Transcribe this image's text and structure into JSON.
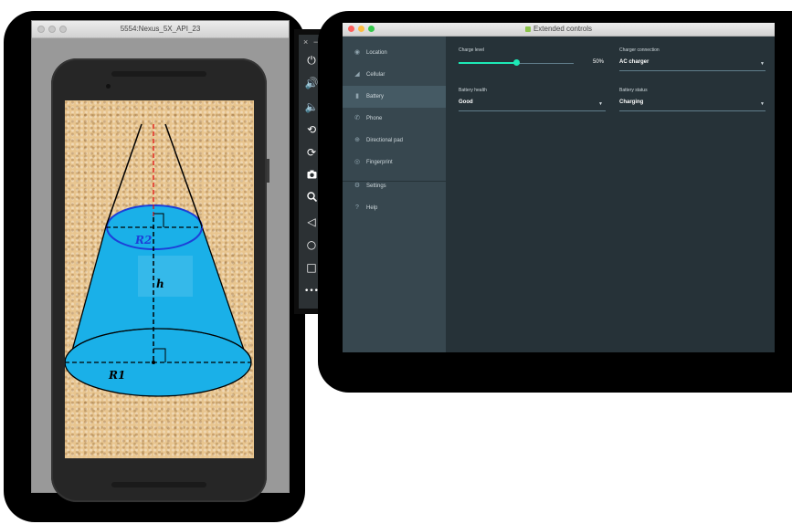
{
  "emulator": {
    "title": "5554:Nexus_5X_API_23",
    "diagram": {
      "label_top_radius": "R2",
      "label_height": "h",
      "label_bottom_radius": "R1"
    }
  },
  "toolbar": {
    "close": "×",
    "minimize": "−",
    "icons": [
      "power-icon",
      "volume-up-icon",
      "volume-down-icon",
      "rotate-left-icon",
      "rotate-right-icon",
      "camera-icon",
      "zoom-icon",
      "back-icon",
      "home-icon",
      "overview-icon",
      "more-icon"
    ]
  },
  "extended_controls": {
    "title": "Extended controls",
    "title_icon_color": "#8bc34a",
    "nav": [
      {
        "label": "Location",
        "icon": "location-icon"
      },
      {
        "label": "Cellular",
        "icon": "cellular-icon"
      },
      {
        "label": "Battery",
        "icon": "battery-icon",
        "active": true
      },
      {
        "label": "Phone",
        "icon": "phone-icon"
      },
      {
        "label": "Directional pad",
        "icon": "dpad-icon"
      },
      {
        "label": "Fingerprint",
        "icon": "fingerprint-icon"
      },
      {
        "label": "Settings",
        "icon": "settings-icon"
      },
      {
        "label": "Help",
        "icon": "help-icon"
      }
    ],
    "battery": {
      "charge_level_label": "Charge level",
      "charge_level_value": "50%",
      "charge_level_fraction": 0.5,
      "charger_connection_label": "Charger connection",
      "charger_connection_value": "AC charger",
      "battery_health_label": "Battery health",
      "battery_health_value": "Good",
      "battery_status_label": "Battery status",
      "battery_status_value": "Charging"
    }
  },
  "colors": {
    "accent": "#1de9b6",
    "sidebar": "#37474f",
    "panel": "#263238",
    "cone_fill": "#1ab0e8"
  }
}
